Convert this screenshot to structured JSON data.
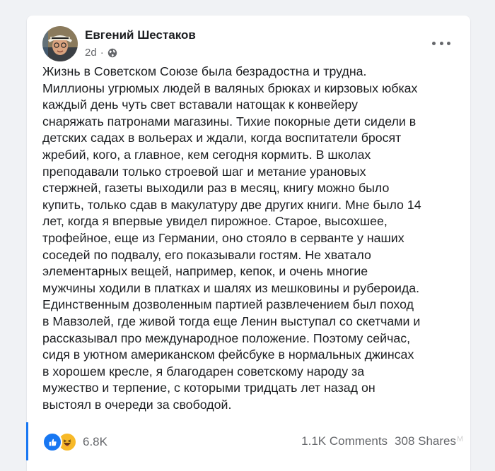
{
  "post": {
    "author": "Евгений Шестаков",
    "time": "2d",
    "separator": "·",
    "privacy_icon": "globe-icon",
    "more_icon": "more-horizontal-icon",
    "text": "Жизнь в Советском Союзе была безрадостна и трудна.\nМиллионы угрюмых людей в валяных брюках и кирзовых юбках\nкаждый день чуть свет вставали натощак к конвейеру\nснаряжать патронами магазины. Тихие покорные дети сидели в\nдетских садах в вольерах и ждали, когда воспитатели бросят\nжребий, кого, а главное, кем сегодня кормить. В школах\nпреподавали только строевой шаг и метание урановых\nстержней, газеты выходили раз в месяц, книгу можно было\nкупить, только сдав в макулатуру две других книги. Мне было 14\nлет, когда я впервые увидел пирожное. Старое, высохшее,\nтрофейное, еще из Германии, оно стояло в серванте у наших\nсоседей по подвалу, его показывали гостям. Не хватало\nэлементарных вещей, например, кепок, и очень многие\nмужчины ходили в платках и шалях из мешковины и рубероида.\nЕдинственным дозволенным партией развлечением был поход\nв Мавзолей, где живой тогда еще Ленин выступал со скетчами и\nрассказывал про международное положение. Поэтому сейчас,\nсидя в уютном американском фейсбуке в нормальных джинсах\nв хорошем кресле, я благодарен советскому народу за\nмужество и терпение, с которыми тридцать лет назад он\nвыстоял в очереди за свободой."
  },
  "footer": {
    "reaction_icons": [
      "like-icon",
      "haha-icon"
    ],
    "reaction_count": "6.8K",
    "comments": "1.1K Comments",
    "shares": "308 Shares"
  },
  "watermark": "M",
  "colors": {
    "background": "#f0f2f5",
    "card": "#ffffff",
    "text": "#1c1e21",
    "secondary_text": "#65676b",
    "like_blue": "#1877f2",
    "haha_yellow": "#f7b928"
  }
}
